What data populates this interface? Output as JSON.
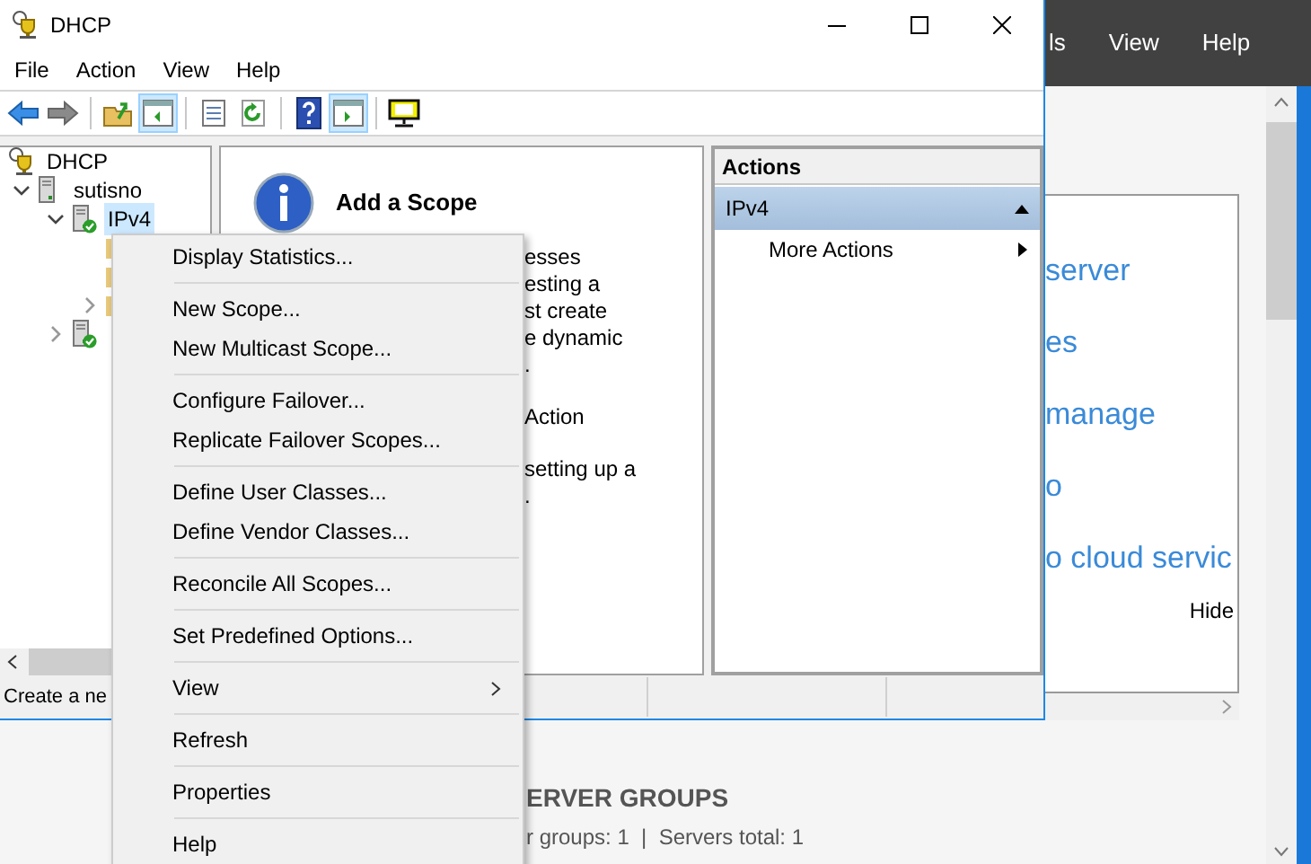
{
  "background_window": {
    "menu": [
      "ls",
      "View",
      "Help"
    ],
    "welcome_lines": [
      "server",
      "es",
      "manage",
      "o",
      "o cloud servic"
    ],
    "hide_link": "Hide",
    "section_title": "ERVER GROUPS",
    "section_summary": "r groups: 1  |  Servers total: 1"
  },
  "window": {
    "title": "DHCP"
  },
  "menu_bar": [
    "File",
    "Action",
    "View",
    "Help"
  ],
  "toolbar": [
    {
      "kind": "back",
      "selected": false
    },
    {
      "kind": "forward",
      "selected": false
    },
    {
      "kind": "separator"
    },
    {
      "kind": "up",
      "selected": false
    },
    {
      "kind": "console_tree",
      "selected": true
    },
    {
      "kind": "separator"
    },
    {
      "kind": "properties",
      "selected": false
    },
    {
      "kind": "refresh",
      "selected": false
    },
    {
      "kind": "separator"
    },
    {
      "kind": "help",
      "selected": false
    },
    {
      "kind": "action_pane",
      "selected": true
    },
    {
      "kind": "separator"
    },
    {
      "kind": "monitor",
      "selected": false
    }
  ],
  "tree": [
    {
      "label": "DHCP",
      "kind": "root",
      "children": [
        {
          "label": "sutisno",
          "kind": "server",
          "expanded": true,
          "children": [
            {
              "label": "IPv4",
              "kind": "protocol",
              "expanded": true,
              "selected": true,
              "children": [
                {
                  "kind": "folder"
                },
                {
                  "kind": "folder"
                },
                {
                  "kind": "folder",
                  "expanded": false
                }
              ]
            },
            {
              "kind": "protocol",
              "expanded": false
            }
          ]
        }
      ]
    }
  ],
  "details": {
    "title": "Add a Scope",
    "fragments": [
      [
        "esses",
        "esting a",
        "st create",
        "e dynamic",
        "."
      ],
      [
        "Action"
      ],
      [
        "setting up a",
        "."
      ]
    ]
  },
  "actions": {
    "title": "Actions",
    "groups": [
      {
        "label": "IPv4",
        "expanded": true,
        "items": [
          {
            "label": "More Actions",
            "submenu": true
          }
        ]
      }
    ]
  },
  "status_bar": "Create a ne",
  "context_menu": [
    {
      "kind": "item",
      "label": "Display Statistics..."
    },
    {
      "kind": "separator"
    },
    {
      "kind": "item",
      "label": "New Scope..."
    },
    {
      "kind": "item",
      "label": "New Multicast Scope..."
    },
    {
      "kind": "separator"
    },
    {
      "kind": "item",
      "label": "Configure Failover..."
    },
    {
      "kind": "item",
      "label": "Replicate Failover Scopes..."
    },
    {
      "kind": "separator"
    },
    {
      "kind": "item",
      "label": "Define User Classes..."
    },
    {
      "kind": "item",
      "label": "Define Vendor Classes..."
    },
    {
      "kind": "separator"
    },
    {
      "kind": "item",
      "label": "Reconcile All Scopes..."
    },
    {
      "kind": "separator"
    },
    {
      "kind": "item",
      "label": "Set Predefined Options..."
    },
    {
      "kind": "separator"
    },
    {
      "kind": "submenu",
      "label": "View"
    },
    {
      "kind": "separator"
    },
    {
      "kind": "item",
      "label": "Refresh"
    },
    {
      "kind": "separator"
    },
    {
      "kind": "item",
      "label": "Properties"
    },
    {
      "kind": "separator"
    },
    {
      "kind": "item",
      "label": "Help"
    }
  ]
}
